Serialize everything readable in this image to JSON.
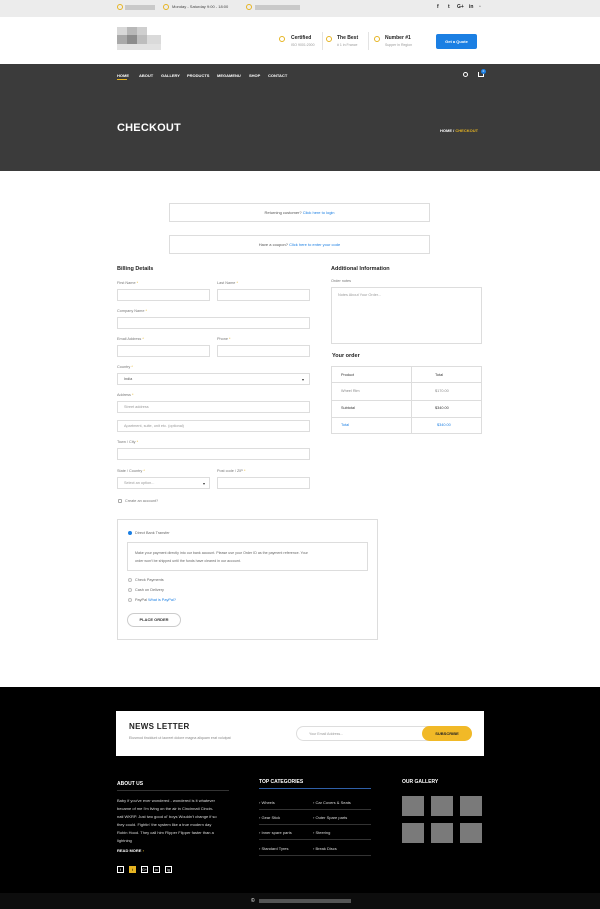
{
  "topbar": {
    "hours": "Monday - Saturday 9:00 - 18:00"
  },
  "social_icons": [
    "f",
    "t",
    "G+",
    "in"
  ],
  "features": [
    {
      "title": "Certified",
      "subtitle": "ISO 9001:2000"
    },
    {
      "title": "The Best",
      "subtitle": "# 1 in France"
    },
    {
      "title": "Number #1",
      "subtitle": "Supper in Region"
    }
  ],
  "quote_button": "Get a Quote",
  "nav": [
    "HOME",
    "ABOUT",
    "GALLERY",
    "PRODUCTS",
    "MEGAMENU",
    "SHOP",
    "CONTACT"
  ],
  "cart_count": "0",
  "page_title": "CHECKOUT",
  "breadcrumb": {
    "home": "HOME",
    "sep": "/",
    "current": "CHECKOUT"
  },
  "notices": {
    "returning_text": "Returning customer?",
    "returning_link": "Click here to login",
    "coupon_text": "Have a coupon?",
    "coupon_link": "Click here to enter your code"
  },
  "billing": {
    "heading": "Billing Details",
    "first_name": "First Name",
    "last_name": "Last Name",
    "company": "Company Name",
    "email": "Email Address",
    "phone": "Phone",
    "country": "Country",
    "country_value": "India",
    "address": "Address",
    "address_placeholder": "Street address",
    "address2_placeholder": "Apartment, suite, unit etc. (optional)",
    "town": "Town / City",
    "state": "State / Country",
    "state_placeholder": "Select an option...",
    "postcode": "Post code / ZIP",
    "create_account": "Create an account?",
    "req": "*"
  },
  "additional": {
    "heading": "Additional Information",
    "notes_label": "Order notes",
    "notes_placeholder": "Notes About Your Order..."
  },
  "order": {
    "heading": "Your order",
    "col_product": "Product",
    "col_total": "Total",
    "item": "Wheel Rim",
    "item_price": "$170.00",
    "subtotal_label": "Subtotal",
    "subtotal": "$340.00",
    "total_label": "Total",
    "total": "$340.00"
  },
  "payment": {
    "bank": "Direct Bank Transfer",
    "bank_desc_1": "Make your payment directly into our bank account. Please use your Order ID as the payment reference. Your",
    "bank_desc_2": "order won't be shipped until the funds have cleared in our account.",
    "check": "Check Payments",
    "cod": "Cash on Delivery",
    "paypal": "PayPal",
    "paypal_link": "What is PayPal?",
    "place_order": "PLACE ORDER"
  },
  "newsletter": {
    "title": "NEWS LETTER",
    "desc": "Eiusmod tincidunt ut laoreet dolore magna aliquam erat volutpat",
    "placeholder": "Your Email Address...",
    "button": "SUBSCRIBE"
  },
  "about": {
    "heading": "ABOUT US",
    "lines": [
      "Baby if you've ever wondered - wondered is it whatever",
      "became of me I'm living on the air in Cincinnati Cincin-",
      "nati WKRP. Just two good ol' boys Wouldn't change if so",
      "they could. Fightin' the system like a true modern day",
      "Robin Hood. They call him Flipper Flipper faster than a",
      "lightning"
    ],
    "read_more": "READ MORE"
  },
  "categories": {
    "heading": "TOP CATEGORIES",
    "items": [
      "Wheels",
      "Car Covers & Seats",
      "Gear Stick",
      "Outer Spare parts",
      "Inner spare parts",
      "Steering",
      "Standard Tyres",
      "Break Discs"
    ]
  },
  "gallery": {
    "heading": "OUR GALLERY"
  },
  "footer_social": [
    "f",
    "t",
    "G+",
    "in",
    "ig"
  ],
  "copyright_symbol": "©",
  "colors": {
    "accent": "#e6b422",
    "link": "#1b7fe3",
    "hero": "#3b3b3b"
  }
}
